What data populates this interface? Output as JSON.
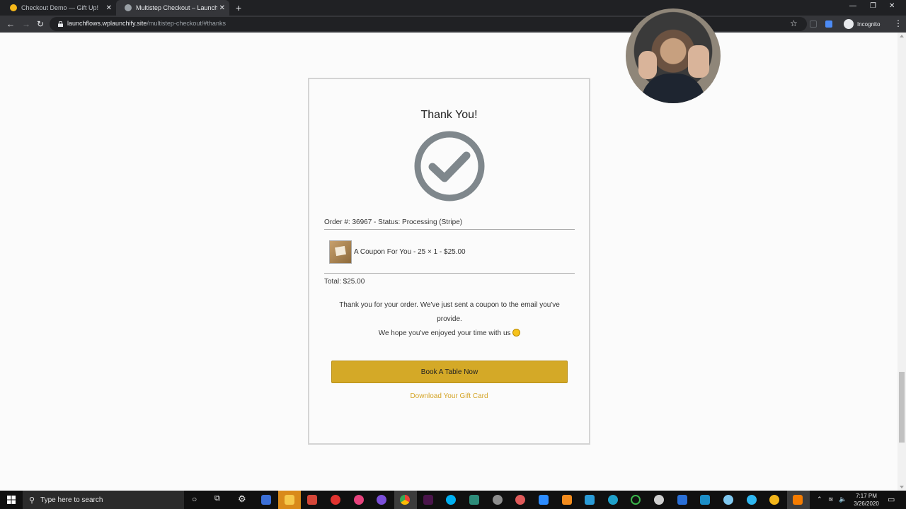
{
  "browser": {
    "tabs": [
      {
        "title": "Checkout Demo — Gift Up!",
        "active": false
      },
      {
        "title": "Multistep Checkout – LaunchFlow",
        "active": true
      }
    ],
    "url_host": "launchflows.wplaunchify.site",
    "url_path": "/multistep-checkout/#thanks",
    "incognito_label": "Incognito"
  },
  "card": {
    "title": "Thank You!",
    "order_line": "Order #: 36967 - Status: Processing (Stripe)",
    "item": "A Coupon For You - 25 × 1 - $25.00",
    "total": "Total: $25.00",
    "message_line1": "Thank you for your order. We've just sent a coupon to the email you've provide.",
    "message_line2": "We hope you've enjoyed your time with us",
    "book_button": "Book A Table Now",
    "download_link": "Download Your Gift Card",
    "accent_color": "#d4a927"
  },
  "taskbar": {
    "search_placeholder": "Type here to search",
    "time": "7:17 PM",
    "date": "3/26/2020"
  }
}
